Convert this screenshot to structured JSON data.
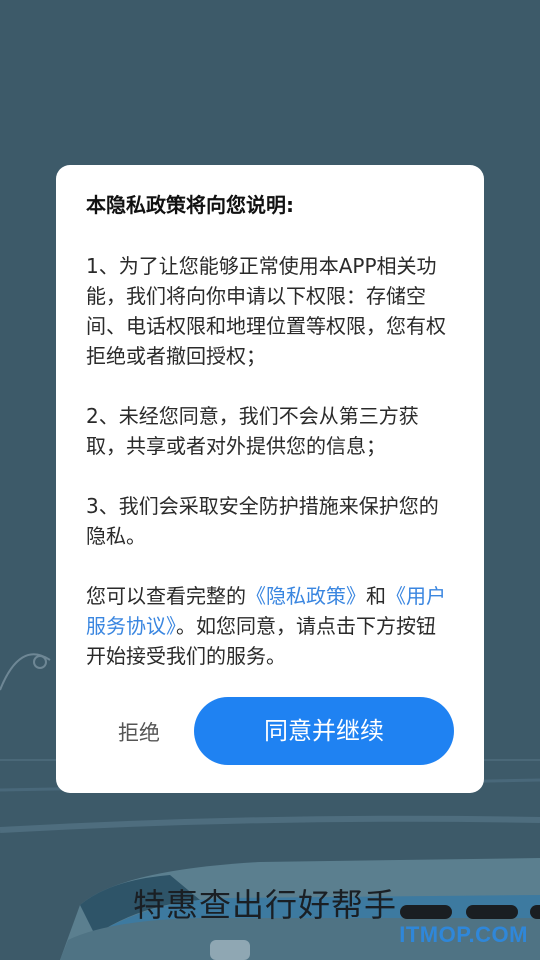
{
  "dialog": {
    "title": "本隐私政策将向您说明:",
    "para1": "1、为了让您能够正常使用本APP相关功能，我们将向你申请以下权限：存储空间、电话权限和地理位置等权限，您有权拒绝或者撤回授权；",
    "para2": "2、未经您同意，我们不会从第三方获取，共享或者对外提供您的信息；",
    "para3": "3、我们会采取安全防护措施来保护您的隐私。",
    "para4_prefix": "您可以查看完整的",
    "privacy_link": "《隐私政策》",
    "and_text": "和",
    "service_link": "《用户服务协议》",
    "para4_suffix": "。如您同意，请点击下方按钮开始接受我们的服务。",
    "reject_label": "拒绝",
    "agree_label": "同意并继续"
  },
  "background": {
    "slogan": "特惠查出行好帮手"
  },
  "watermark": "ITMOP.COM",
  "colors": {
    "background": "#3d5a69",
    "accent": "#1f82f2",
    "link": "#3a86e0"
  }
}
